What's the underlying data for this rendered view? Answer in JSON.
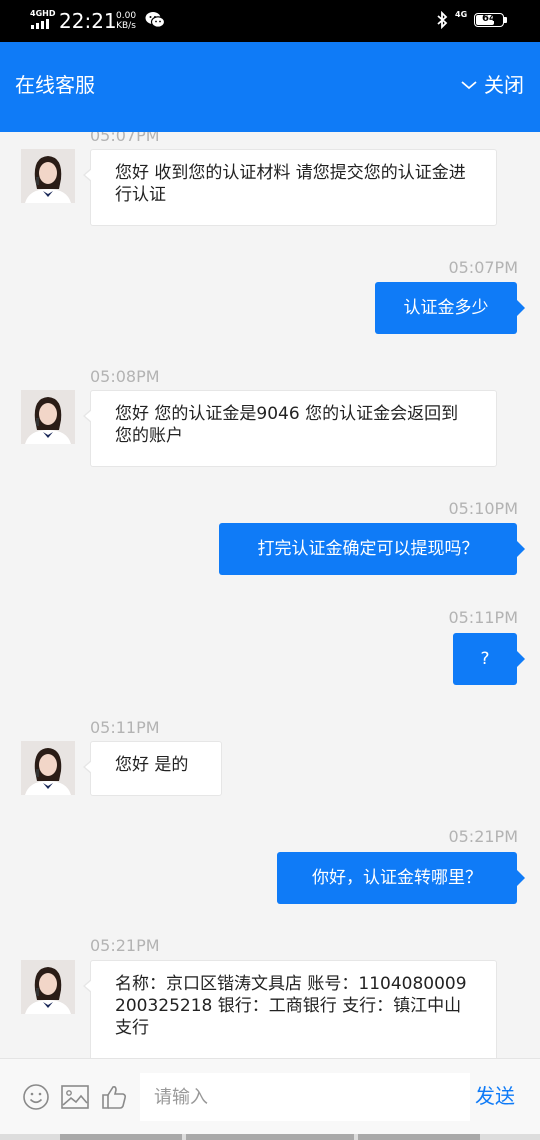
{
  "status_bar": {
    "network": "4GHD",
    "time": "22:21",
    "speed_value": "0.00",
    "speed_unit": "KB/s",
    "cell_label": "4G",
    "battery": "64"
  },
  "header": {
    "title": "在线客服",
    "close_label": "关闭",
    "color": "#0f7bf7"
  },
  "messages": [
    {
      "side": "agent",
      "time": "05:07PM",
      "text": "您好 收到您的认证材料 请您提交您的认证金进行认证"
    },
    {
      "side": "user",
      "time": "05:07PM",
      "text": "认证金多少"
    },
    {
      "side": "agent",
      "time": "05:08PM",
      "text": "您好 您的认证金是9046 您的认证金会返回到您的账户"
    },
    {
      "side": "user",
      "time": "05:10PM",
      "text": "打完认证金确定可以提现吗？"
    },
    {
      "side": "user",
      "time": "05:11PM",
      "text": "?"
    },
    {
      "side": "agent",
      "time": "05:11PM",
      "text": "您好 是的"
    },
    {
      "side": "user",
      "time": "05:21PM",
      "text": "你好，认证金转哪里？"
    },
    {
      "side": "agent",
      "time": "05:21PM",
      "text": "名称：京口区锴涛文具店 账号：1104080009200325218 银行：工商银行 支行：镇江中山支行"
    }
  ],
  "input": {
    "placeholder": "请输入",
    "send_label": "发送",
    "icons": [
      "emoji-icon",
      "image-icon",
      "thumbs-up-icon"
    ]
  }
}
